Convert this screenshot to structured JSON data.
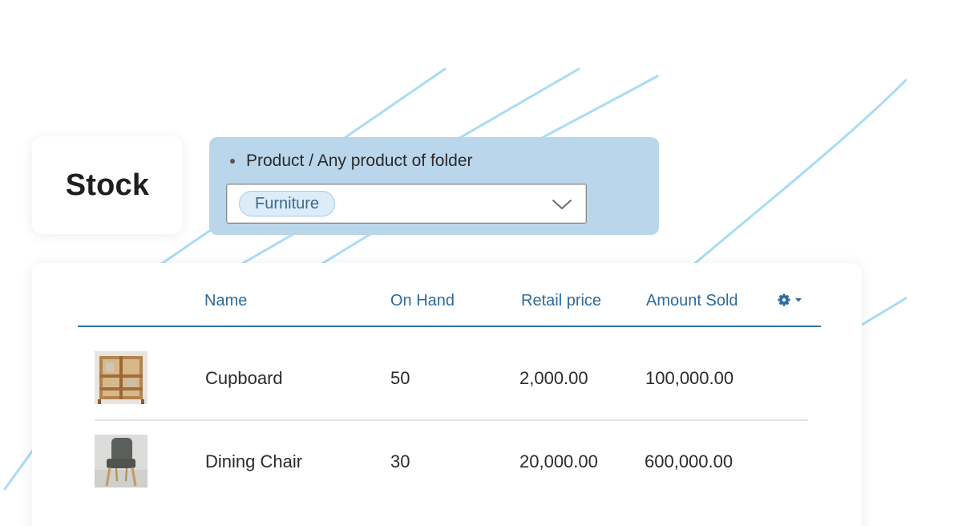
{
  "page": {
    "title": "Stock"
  },
  "filter": {
    "label": "Product / Any product of folder",
    "selected_tag": "Furniture",
    "icons": {
      "bullet": "bullet-dot-icon",
      "expand": "chevron-down-icon"
    }
  },
  "table": {
    "columns": [
      "Name",
      "On Hand",
      "Retail price",
      "Amount Sold"
    ],
    "settings_icon": "gear-dropdown-icon",
    "rows": [
      {
        "thumbnail": "cupboard-thumbnail",
        "name": "Cupboard",
        "on_hand": "50",
        "retail_price": "2,000.00",
        "amount_sold": "100,000.00"
      },
      {
        "thumbnail": "dining-chair-thumbnail",
        "name": "Dining Chair",
        "on_hand": "30",
        "retail_price": "20,000.00",
        "amount_sold": "600,000.00"
      }
    ]
  },
  "colors": {
    "accent": "#2d6b9c",
    "filter_bg": "#b9d6ea",
    "tag_bg": "#dcecf8",
    "decor_lines": "#a8dcf5"
  }
}
